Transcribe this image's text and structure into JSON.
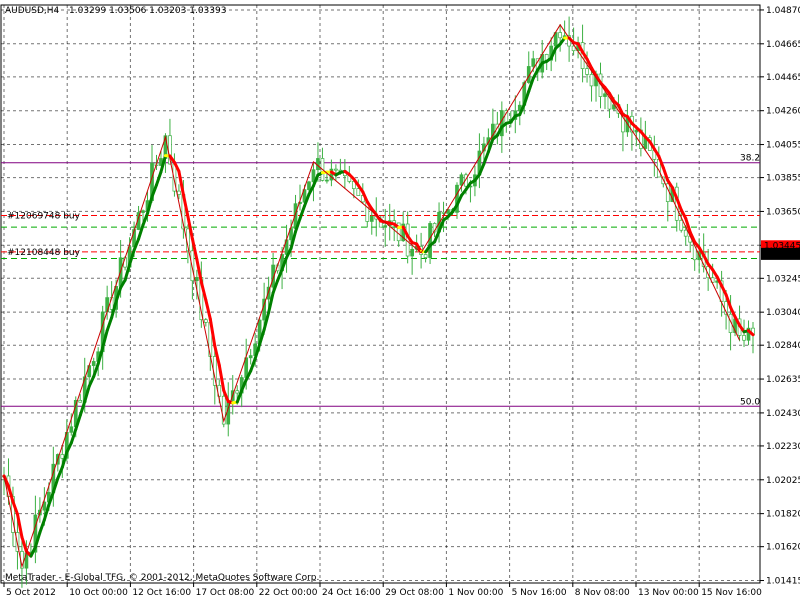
{
  "header": {
    "symbol": "AUDUSD,H4",
    "ohlc": "1.03299 1.03506 1.03203 1.03393"
  },
  "footer": {
    "copyright": "MetaTrader - E-Global TFG, © 2001-2012, MetaQuotes Software Corp."
  },
  "colors": {
    "background": "#ffffff",
    "grid": "#000000",
    "candle": "#3cb043",
    "trend_up": "#008000",
    "trend_down": "#ff0000",
    "trend_flat": "#ffff00",
    "zigzag": "#cc0000",
    "fibo": "#800080",
    "order_line": "#ff0000",
    "order_tp": "#00aa00",
    "price_label_bg": "#000000",
    "price_label_fg": "#ffffff"
  },
  "chart_data": {
    "type": "candlestick",
    "symbol": "AUDUSD",
    "timeframe": "H4",
    "ylim": [
      1.014,
      1.049
    ],
    "y_ticks": [
      "1.04870",
      "1.04665",
      "1.04465",
      "1.04260",
      "1.04055",
      "1.03855",
      "1.03650",
      "1.03445",
      "1.03245",
      "1.03040",
      "1.02840",
      "1.02635",
      "1.02430",
      "1.02230",
      "1.02025",
      "1.01820",
      "1.01620",
      "1.01415"
    ],
    "x_ticks": [
      "5 Oct 2012",
      "10 Oct 00:00",
      "12 Oct 16:00",
      "17 Oct 08:00",
      "22 Oct 00:00",
      "24 Oct 16:00",
      "29 Oct 08:00",
      "1 Nov 00:00",
      "5 Nov 16:00",
      "8 Nov 08:00",
      "13 Nov 00:00",
      "15 Nov 16:00"
    ],
    "current_price": "1.03393",
    "bid_marker": "1.03445",
    "zigzag_points": [
      [
        0,
        1.0205
      ],
      [
        4,
        1.015
      ],
      [
        36,
        1.041
      ],
      [
        49,
        1.0238
      ],
      [
        69,
        1.0395
      ],
      [
        93,
        1.034
      ],
      [
        124,
        1.0478
      ],
      [
        146,
        1.039
      ],
      [
        164,
        1.0287
      ]
    ],
    "fibo_levels": [
      {
        "label": "38.2",
        "price": 1.03945
      },
      {
        "label": "50.0",
        "price": 1.0247
      }
    ],
    "orders": [
      {
        "label": "#12069748 buy",
        "price": 1.03625
      },
      {
        "label": "#12108448 buy",
        "price": 1.03405
      }
    ],
    "order_targets": [
      1.03555,
      1.03365
    ],
    "grid": true
  }
}
